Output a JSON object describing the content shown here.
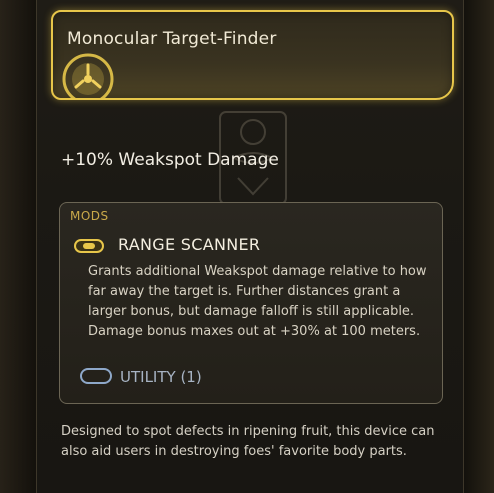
{
  "item": {
    "name": "Monocular Target-Finder",
    "stat": "+10% Weakspot Damage",
    "rarity_color": "#e7c64a"
  },
  "mods": {
    "section_label": "MODS",
    "mod_name": "RANGE SCANNER",
    "mod_icon": "range-scanner-icon",
    "description": "Grants additional Weakspot damage relative to how far away the target is. Further distances grant a larger bonus, but damage falloff is still applicable. Damage bonus maxes out at +30% at 100 meters.",
    "slot_type": "UTILITY (1)",
    "slot_icon": "utility-slot-icon"
  },
  "flavor_text": "Designed to spot defects in ripening fruit, this device can also aid users in destroying foes' favorite body parts.",
  "colors": {
    "accent_gold": "#e7c64a",
    "mods_label": "#c9a84a",
    "utility_blue": "#8ea8c9"
  }
}
